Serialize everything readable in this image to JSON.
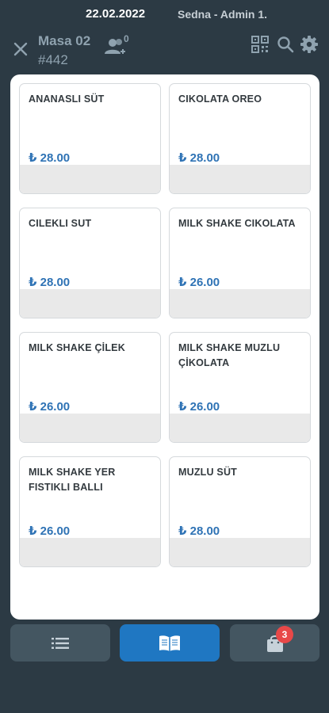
{
  "status_bar": {
    "date": "22.02.2022",
    "user": "Sedna - Admin 1."
  },
  "header": {
    "table_name": "Masa 02",
    "order_number": "#442",
    "guest_count": "0"
  },
  "products": [
    {
      "name": "ANANASLI SÜT",
      "price": "₺ 28.00"
    },
    {
      "name": "CIKOLATA OREO",
      "price": "₺ 28.00"
    },
    {
      "name": "CILEKLI SUT",
      "price": "₺ 28.00"
    },
    {
      "name": "MILK SHAKE CIKOLATA",
      "price": "₺ 26.00"
    },
    {
      "name": "MILK SHAKE ÇİLEK",
      "price": "₺ 26.00"
    },
    {
      "name": "MILK SHAKE MUZLU ÇİKOLATA",
      "price": "₺ 26.00"
    },
    {
      "name": "MILK SHAKE YER FISTIKLI BALLI",
      "price": "₺ 26.00"
    },
    {
      "name": "MUZLU SÜT",
      "price": "₺ 28.00"
    }
  ],
  "bottom_nav": {
    "cart_badge": "3"
  },
  "colors": {
    "background": "#2c3a44",
    "accent": "#1f77c2",
    "price": "#2f73b5",
    "badge": "#e84848"
  }
}
